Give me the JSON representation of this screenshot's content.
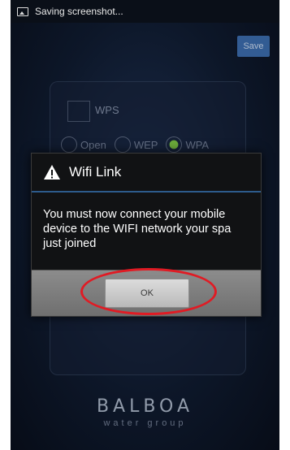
{
  "status_bar": {
    "notification": "Saving screenshot..."
  },
  "background": {
    "save_label": "Save",
    "wps_label": "WPS",
    "security_options": [
      "Open",
      "WEP",
      "WPA"
    ],
    "selected_security": "WPA"
  },
  "dialog": {
    "icon": "warning-icon",
    "title": "Wifi Link",
    "message": "You must now connect your mobile device to the WIFI network your spa just joined",
    "ok_label": "OK"
  },
  "logo": {
    "name": "BALBOA",
    "tagline": "water group"
  },
  "colors": {
    "highlight_ring": "#e01b24",
    "dialog_accent": "#2d5b8c"
  }
}
